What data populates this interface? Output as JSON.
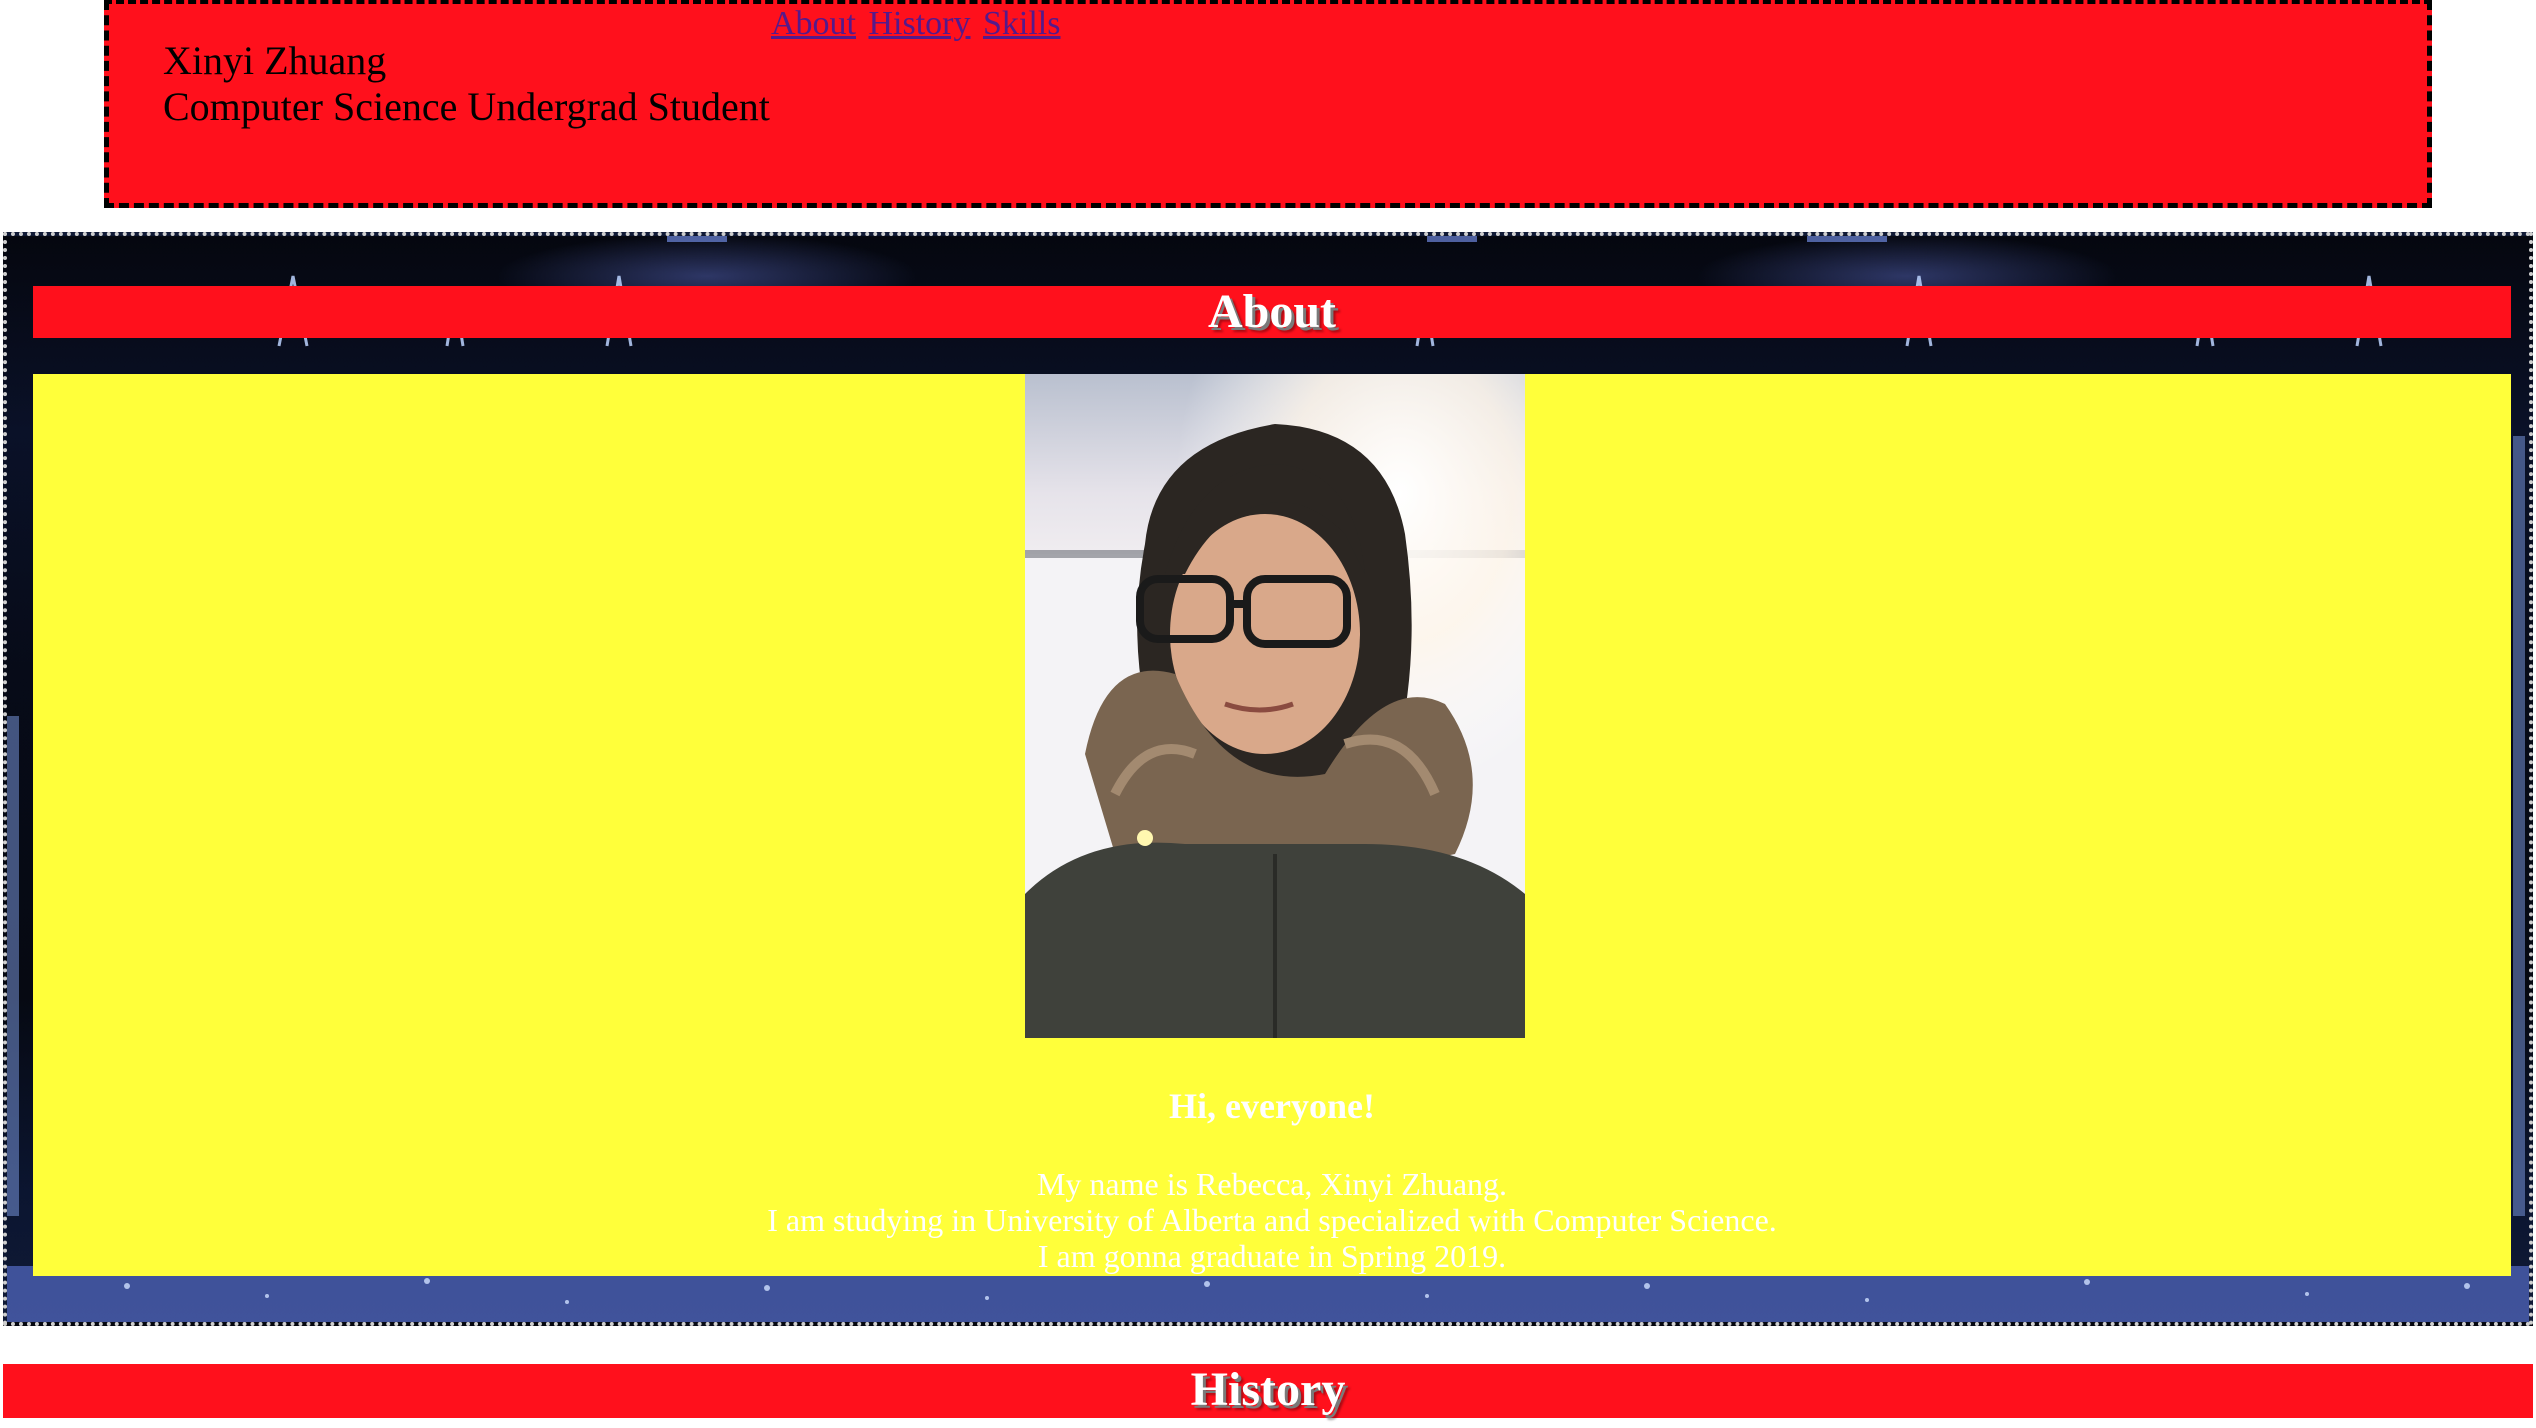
{
  "header": {
    "name": "Xinyi Zhuang",
    "subtitle": "Computer Science Undergrad Student"
  },
  "nav": {
    "links": [
      "About",
      "History",
      "Skills"
    ]
  },
  "about": {
    "title": "About",
    "greeting": "Hi, everyone!",
    "bio_lines": [
      "My name is Rebecca, Xinyi Zhuang.",
      "I am studying in University of Alberta and specialized with Computer Science.",
      "I am gonna graduate in Spring 2019."
    ]
  },
  "history": {
    "title": "History"
  },
  "colors": {
    "header_bg": "#ff101c",
    "about_body_bg": "#ffff3a",
    "link": "#551a8b"
  }
}
